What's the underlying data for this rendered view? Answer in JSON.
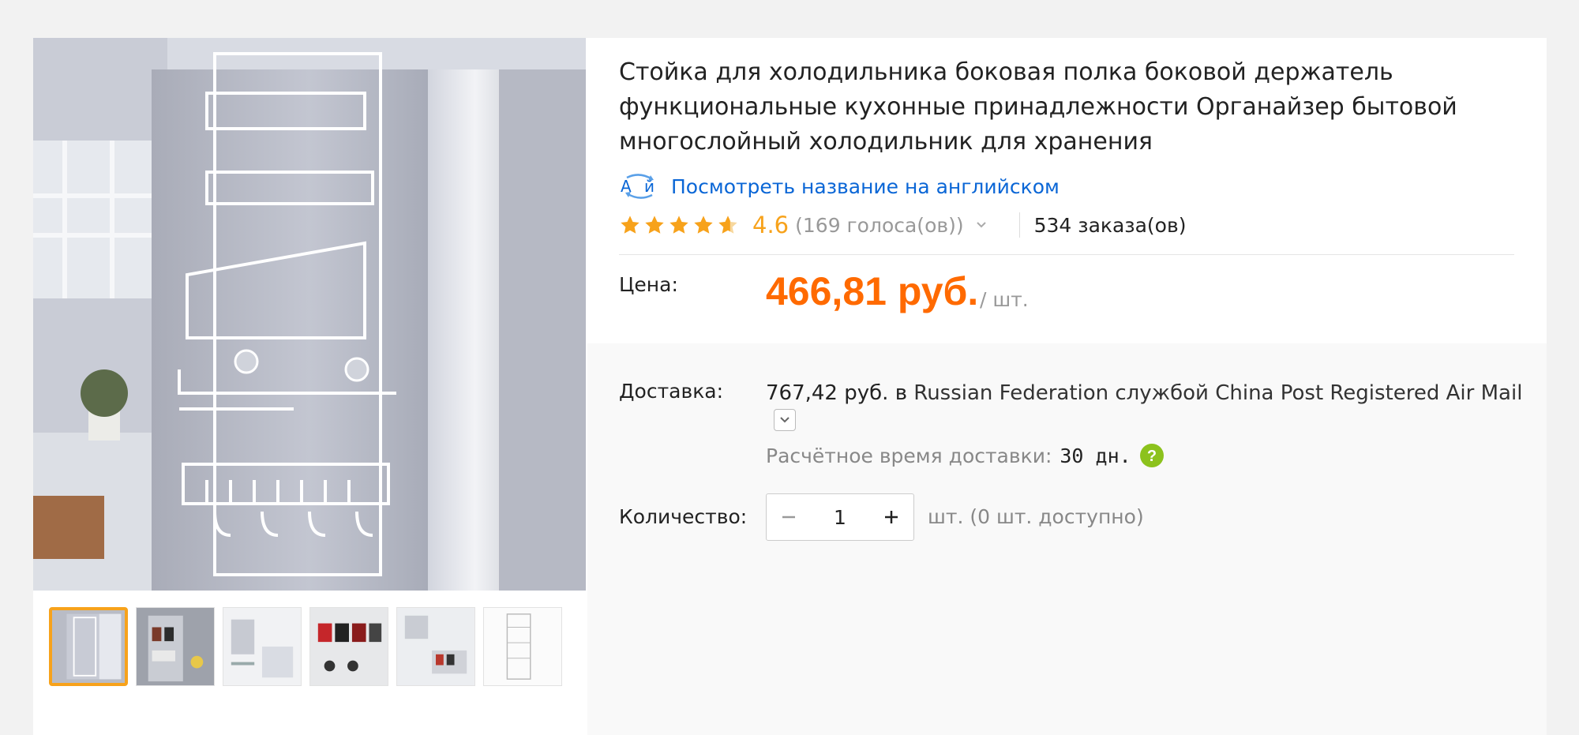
{
  "product": {
    "title": "Стойка для холодильника боковая полка боковой держатель функциональные кухонные принадлежности Органайзер бытовой многослойный холодильник для хранения",
    "translate_link": "Посмотреть название на английском",
    "rating_value": "4.6",
    "rating_stars": 4.6,
    "votes": "(169 голоса(ов))",
    "orders": "534 заказа(ов)"
  },
  "price": {
    "label": "Цена:",
    "value": "466,81 руб.",
    "unit": "/ шт."
  },
  "delivery": {
    "label": "Доставка:",
    "cost": "767,42 руб.",
    "to_word": "в",
    "destination_text": "Russian Federation службой China Post Registered Air Mail",
    "eta_label": "Расчётное время доставки:",
    "eta_value": "30 дн."
  },
  "quantity": {
    "label": "Количество:",
    "value": "1",
    "availability": "шт. (0 шт. доступно)"
  },
  "gallery": {
    "thumbnails": [
      {
        "id": "thumb-1",
        "active": true
      },
      {
        "id": "thumb-2",
        "active": false
      },
      {
        "id": "thumb-3",
        "active": false
      },
      {
        "id": "thumb-4",
        "active": false
      },
      {
        "id": "thumb-5",
        "active": false
      },
      {
        "id": "thumb-6",
        "active": false
      }
    ]
  },
  "colors": {
    "accent_orange": "#ff6a00",
    "star_orange": "#f7a21b",
    "link_blue": "#0a66d6",
    "help_green": "#8cc21d"
  },
  "icons": {
    "translate": "translate-icon",
    "star": "star-icon",
    "chevron": "chevron-down-icon",
    "help": "question-mark-icon",
    "minus": "minus-icon",
    "plus": "plus-icon"
  }
}
